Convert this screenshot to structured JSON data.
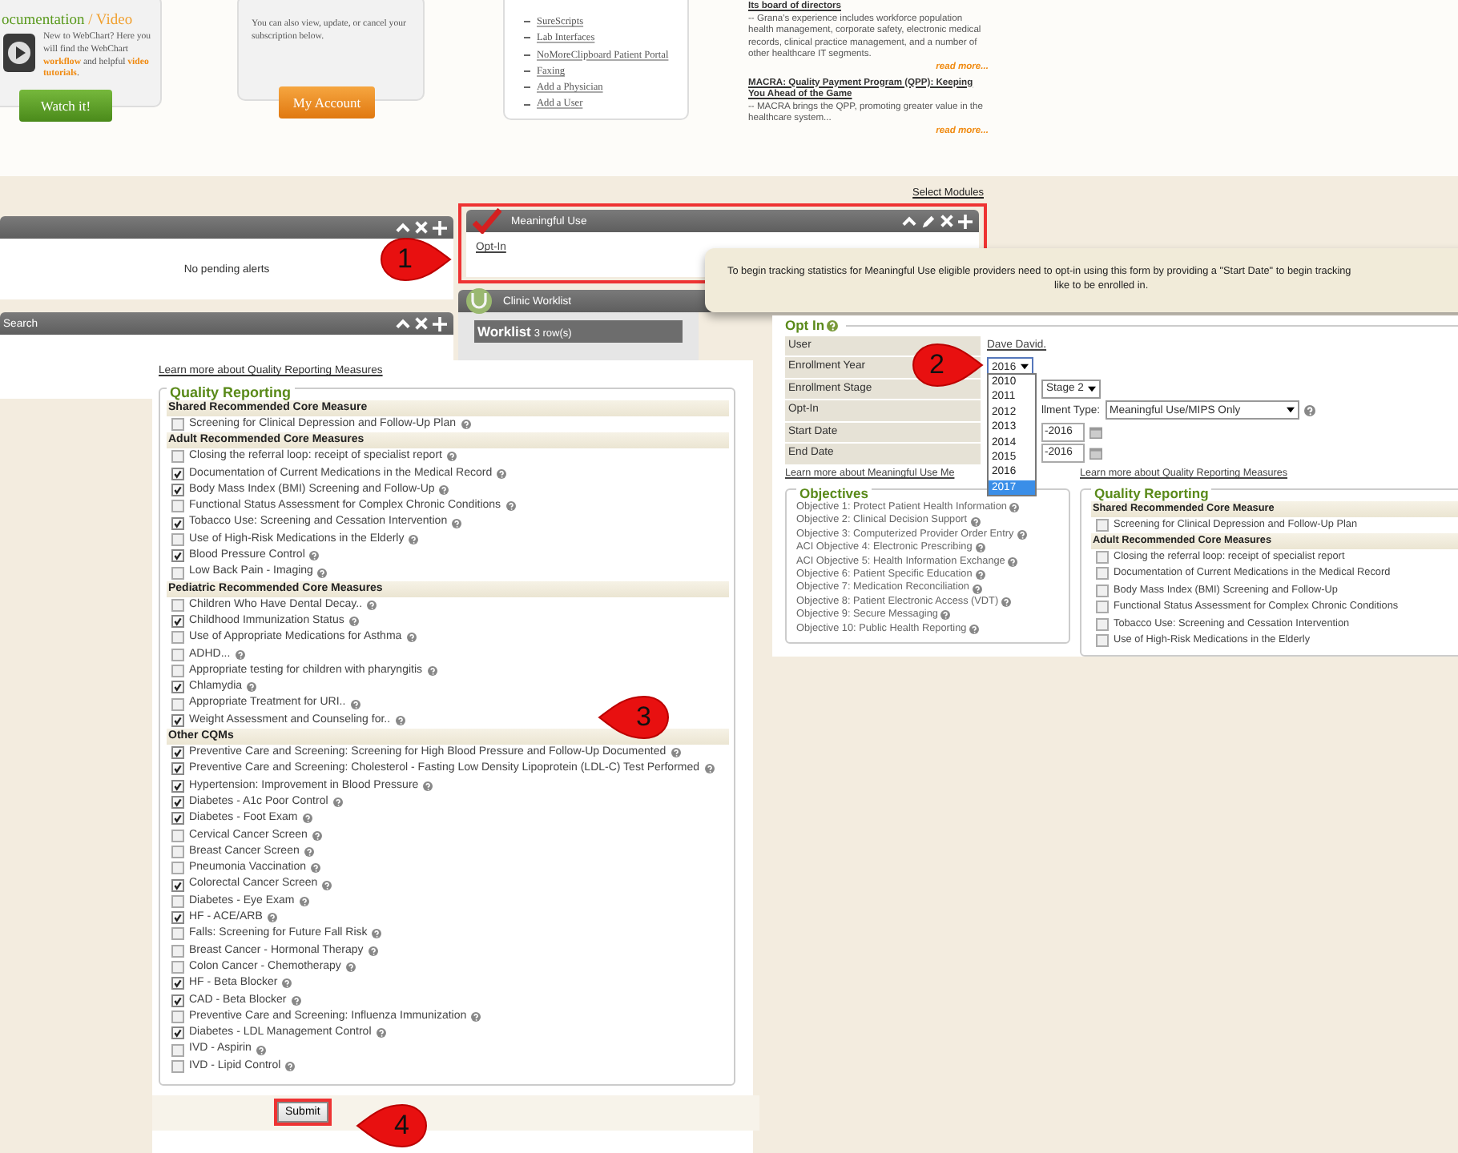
{
  "documentation_card": {
    "title": "ocumentation",
    "title_accent": "/ Video",
    "text": "New to WebChart?  Here you will find the WebChart **workflow** and helpful **video tutorials**.",
    "button": "Watch it!"
  },
  "account_card": {
    "text": "You can also view, update, or cancel your subscription below.",
    "button": "My Account"
  },
  "links_card": {
    "links": [
      "SureScripts",
      "Lab Interfaces",
      "NoMoreClipboard Patient Portal",
      "Faxing",
      "Add a Physician",
      "Add a User"
    ]
  },
  "news": [
    {
      "link": "Its board of directors ",
      "summary": "-- Grana's experience includes workforce population health management, corporate safety, electronic medical records, clinical practice management, and a number of other healthcare IT segments.",
      "more": "read more..."
    },
    {
      "link": "MACRA: Quality Payment Program (QPP): Keeping You Ahead of the Game ",
      "summary": "-- MACRA brings the QPP, promoting greater value in the healthcare system...",
      "more": "read more..."
    }
  ],
  "select_modules": "Select Modules",
  "alerts_panel": {
    "message": "No pending alerts"
  },
  "search_panel": {
    "title": "Search"
  },
  "meaningful_use_panel": {
    "title": "Meaningful Use",
    "link": "Opt-In"
  },
  "worklist_panel": {
    "title": "Clinic Worklist",
    "heading": "Worklist",
    "count": "3 row(s)"
  },
  "tooltip": {
    "lines": [
      "To begin tracking statistics for Meaningful Use eligible providers need to opt-in using this form by providing a \"Start Date\" to begin tracking",
      "like to be enrolled in."
    ]
  },
  "opt_in": {
    "title": "Opt In",
    "user_label": "User",
    "user": "Dave David.",
    "year_label": "Enrollment Year",
    "year": "2016",
    "stage_label": "Enrollment Stage",
    "stage": "Stage 2",
    "optin_label": "Opt-In",
    "type_label": "llment Type:",
    "type": "Meaningful Use/MIPS Only",
    "start_label": "Start Date",
    "start": "-2016",
    "end_label": "End Date",
    "end": "-2016",
    "year_options": [
      {
        "label": "2010",
        "selected": false
      },
      {
        "label": "2011",
        "selected": false
      },
      {
        "label": "2012",
        "selected": false
      },
      {
        "label": "2013",
        "selected": false
      },
      {
        "label": "2014",
        "selected": false
      },
      {
        "label": "2015",
        "selected": false
      },
      {
        "label": "2016",
        "selected": false
      },
      {
        "label": "2017",
        "selected": true
      }
    ],
    "learn_mu": "Learn more about Meaningful Use Me",
    "learn_qr": "Learn more about Quality Reporting Measures",
    "objectives_title": "Objectives",
    "objectives": [
      "Objective 1: Protect Patient Health Information",
      "Objective 2: Clinical Decision Support",
      "Objective 3: Computerized Provider Order Entry",
      "ACI Objective 4: Electronic Prescribing",
      "ACI Objective 5: Health Information Exchange",
      "Objective 6: Patient Specific Education",
      "Objective 7: Medication Reconciliation",
      "Objective 8: Patient Electronic Access (VDT)",
      "Objective 9: Secure Messaging",
      "Objective 10: Public Health Reporting"
    ],
    "qr_title": "Quality Reporting",
    "qr_groups": [
      {
        "heading": "Shared Recommended Core Measure",
        "items": [
          {
            "label": "Screening for Clinical Depression and Follow-Up Plan",
            "checked": false
          }
        ]
      },
      {
        "heading": "Adult Recommended Core Measures",
        "items": [
          {
            "label": "Closing the referral loop: receipt of specialist report",
            "checked": false
          },
          {
            "label": "Documentation of Current Medications in the Medical Record",
            "checked": false
          },
          {
            "label": "Body Mass Index (BMI) Screening and Follow-Up",
            "checked": false
          },
          {
            "label": "Functional Status Assessment for Complex Chronic Conditions",
            "checked": false
          },
          {
            "label": "Tobacco Use: Screening and Cessation Intervention",
            "checked": false
          },
          {
            "label": "Use of High-Risk Medications in the Elderly",
            "checked": false
          }
        ]
      }
    ]
  },
  "quality_reporting": {
    "learn_more": "Learn more about Quality Reporting Measures",
    "title": "Quality Reporting",
    "submit": "Submit",
    "groups": [
      {
        "heading": "Shared Recommended Core Measure",
        "items": [
          {
            "label": "Screening for Clinical Depression and Follow-Up Plan",
            "checked": false
          }
        ]
      },
      {
        "heading": "Adult Recommended Core Measures",
        "items": [
          {
            "label": "Closing the referral loop: receipt of specialist report",
            "checked": false
          },
          {
            "label": "Documentation of Current Medications in the Medical Record",
            "checked": true
          },
          {
            "label": "Body Mass Index (BMI) Screening and Follow-Up",
            "checked": true
          },
          {
            "label": "Functional Status Assessment for Complex Chronic Conditions",
            "checked": false
          },
          {
            "label": "Tobacco Use: Screening and Cessation Intervention",
            "checked": true
          },
          {
            "label": "Use of High-Risk Medications in the Elderly",
            "checked": false
          },
          {
            "label": "Blood Pressure Control",
            "checked": true
          },
          {
            "label": "Low Back Pain - Imaging",
            "checked": false
          }
        ]
      },
      {
        "heading": "Pediatric Recommended Core Measures",
        "items": [
          {
            "label": "Children Who Have Dental Decay..",
            "checked": false
          },
          {
            "label": "Childhood Immunization Status",
            "checked": true
          },
          {
            "label": "Use of Appropriate Medications for Asthma",
            "checked": false
          },
          {
            "label": "ADHD...",
            "checked": false
          },
          {
            "label": "Appropriate testing for children with pharyngitis",
            "checked": false
          },
          {
            "label": "Chlamydia",
            "checked": true
          },
          {
            "label": "Appropriate Treatment for URI..",
            "checked": false
          },
          {
            "label": "Weight Assessment and Counseling for..",
            "checked": true
          }
        ]
      },
      {
        "heading": "Other CQMs",
        "items": [
          {
            "label": "Preventive Care and Screening: Screening for High Blood Pressure and Follow-Up Documented",
            "checked": true
          },
          {
            "label": "Preventive Care and Screening: Cholesterol - Fasting Low Density Lipoprotein (LDL-C) Test Performed",
            "checked": true
          },
          {
            "label": "Hypertension: Improvement in Blood Pressure",
            "checked": true
          },
          {
            "label": "Diabetes - A1c Poor Control",
            "checked": true
          },
          {
            "label": "Diabetes - Foot Exam",
            "checked": true
          },
          {
            "label": "Cervical Cancer Screen",
            "checked": false
          },
          {
            "label": "Breast Cancer Screen",
            "checked": false
          },
          {
            "label": "Pneumonia Vaccination",
            "checked": false
          },
          {
            "label": "Colorectal Cancer Screen",
            "checked": true
          },
          {
            "label": "Diabetes - Eye Exam",
            "checked": false
          },
          {
            "label": "HF - ACE/ARB",
            "checked": true
          },
          {
            "label": "Falls: Screening for Future Fall Risk",
            "checked": false
          },
          {
            "label": "Breast Cancer - Hormonal Therapy",
            "checked": false
          },
          {
            "label": "Colon Cancer - Chemotherapy",
            "checked": false
          },
          {
            "label": "HF - Beta Blocker",
            "checked": true
          },
          {
            "label": "CAD - Beta Blocker",
            "checked": true
          },
          {
            "label": "Preventive Care and Screening: Influenza Immunization",
            "checked": false
          },
          {
            "label": "Diabetes - LDL Management Control",
            "checked": true
          },
          {
            "label": "IVD - Aspirin",
            "checked": false
          },
          {
            "label": "IVD - Lipid Control",
            "checked": false
          }
        ]
      }
    ]
  },
  "callouts": [
    {
      "number": "1",
      "kind": "right"
    },
    {
      "number": "2",
      "kind": "right"
    },
    {
      "number": "3",
      "kind": "left"
    },
    {
      "number": "4",
      "kind": "left"
    }
  ]
}
